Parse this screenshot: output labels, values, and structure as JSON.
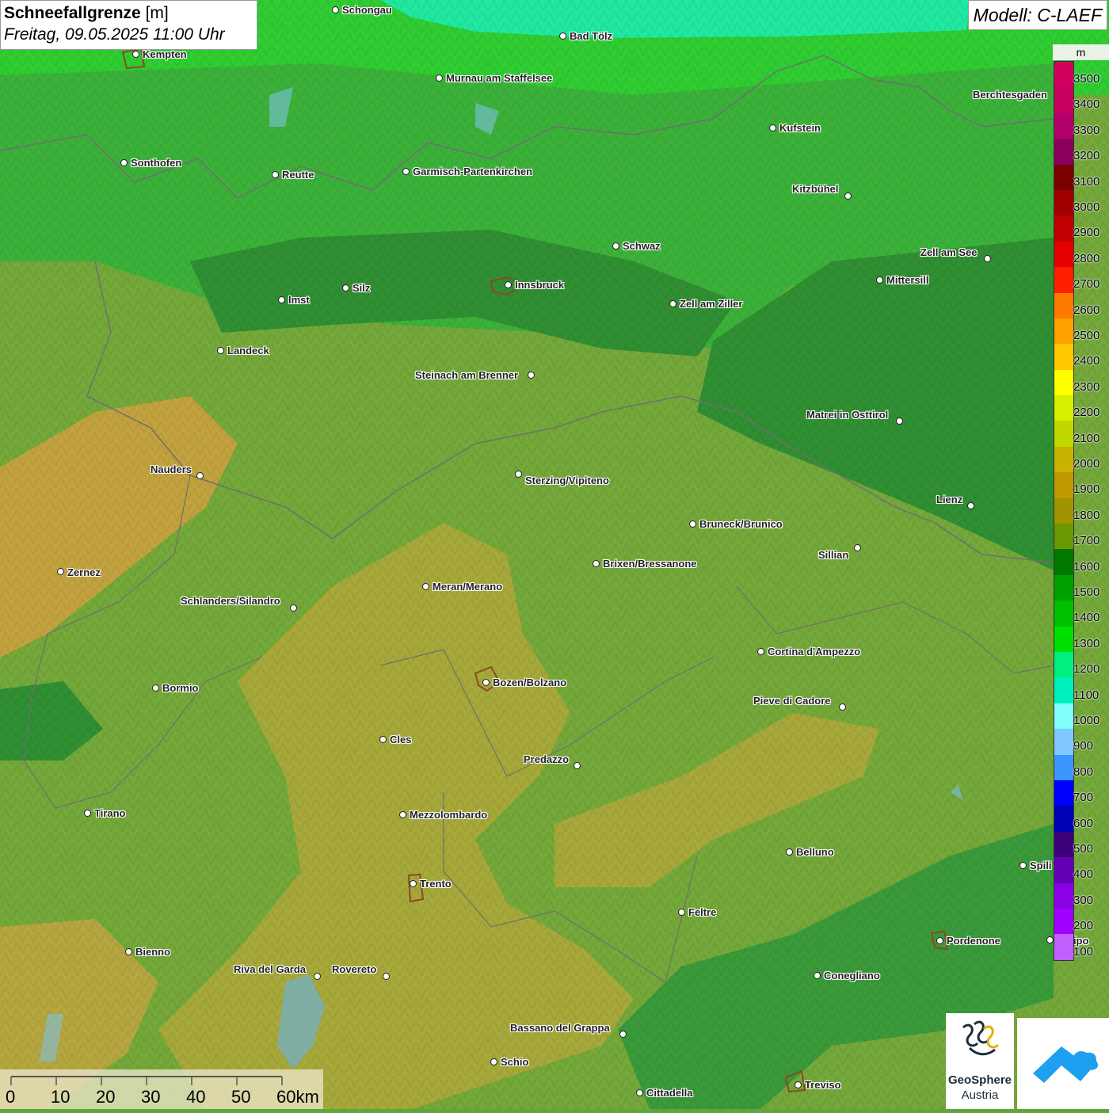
{
  "header": {
    "title_bold": "Schneefallgrenze",
    "title_unit": "[m]",
    "datetime": "Freitag, 09.05.2025 11:00 Uhr",
    "model": "Modell: C-LAEF"
  },
  "legend": {
    "unit": "m",
    "bins": [
      {
        "label": "3500",
        "color": "#d0005e"
      },
      {
        "label": "3400",
        "color": "#c80060"
      },
      {
        "label": "3300",
        "color": "#b3006a"
      },
      {
        "label": "3200",
        "color": "#8b005a"
      },
      {
        "label": "3100",
        "color": "#7a0000"
      },
      {
        "label": "3000",
        "color": "#a00000"
      },
      {
        "label": "2900",
        "color": "#c00000"
      },
      {
        "label": "2800",
        "color": "#e60000"
      },
      {
        "label": "2700",
        "color": "#ff2000"
      },
      {
        "label": "2600",
        "color": "#ff7a00"
      },
      {
        "label": "2500",
        "color": "#ffa000"
      },
      {
        "label": "2400",
        "color": "#ffc800"
      },
      {
        "label": "2300",
        "color": "#ffff00"
      },
      {
        "label": "2200",
        "color": "#d4f000"
      },
      {
        "label": "2100",
        "color": "#c0d800"
      },
      {
        "label": "2000",
        "color": "#c8b400"
      },
      {
        "label": "1900",
        "color": "#c09a00"
      },
      {
        "label": "1800",
        "color": "#a09400"
      },
      {
        "label": "1700",
        "color": "#6a9800"
      },
      {
        "label": "1600",
        "color": "#007800"
      },
      {
        "label": "1500",
        "color": "#00a000"
      },
      {
        "label": "1400",
        "color": "#00c000"
      },
      {
        "label": "1300",
        "color": "#00e000"
      },
      {
        "label": "1200",
        "color": "#00f080"
      },
      {
        "label": "1100",
        "color": "#00f0c0"
      },
      {
        "label": "1000",
        "color": "#80ffff"
      },
      {
        "label": "900",
        "color": "#80c8ff"
      },
      {
        "label": "800",
        "color": "#3c96ff"
      },
      {
        "label": "700",
        "color": "#0000ff"
      },
      {
        "label": "600",
        "color": "#0000b4"
      },
      {
        "label": "500",
        "color": "#3c0078"
      },
      {
        "label": "400",
        "color": "#6400b4"
      },
      {
        "label": "300",
        "color": "#8c00e6"
      },
      {
        "label": "200",
        "color": "#a000ff"
      },
      {
        "label": "100",
        "color": "#c060ff"
      }
    ]
  },
  "cities": [
    {
      "name": "Schongau",
      "side": "right"
    },
    {
      "name": "Bad Tölz",
      "side": "right"
    },
    {
      "name": "Kempten",
      "side": "right"
    },
    {
      "name": "Murnau am Staffelsee",
      "side": "right"
    },
    {
      "name": "Berchtesgaden",
      "side": "left"
    },
    {
      "name": "Kufstein",
      "side": "right"
    },
    {
      "name": "Sonthofen",
      "side": "right"
    },
    {
      "name": "Reutte",
      "side": "right"
    },
    {
      "name": "Garmisch-Partenkirchen",
      "side": "right"
    },
    {
      "name": "Kitzbühel",
      "side": "left"
    },
    {
      "name": "Schwaz",
      "side": "right"
    },
    {
      "name": "Zell am See",
      "side": "left"
    },
    {
      "name": "Innsbruck",
      "side": "right"
    },
    {
      "name": "Silz",
      "side": "right"
    },
    {
      "name": "Imst",
      "side": "right"
    },
    {
      "name": "Mittersill",
      "side": "right"
    },
    {
      "name": "Zell am Ziller",
      "side": "right"
    },
    {
      "name": "Landeck",
      "side": "right"
    },
    {
      "name": "Steinach am Brenner",
      "side": "left"
    },
    {
      "name": "Matrei in Osttirol",
      "side": "left"
    },
    {
      "name": "Nauders",
      "side": "left"
    },
    {
      "name": "Sterzing/Vipiteno",
      "side": "right"
    },
    {
      "name": "Lienz",
      "side": "left"
    },
    {
      "name": "Bruneck/Brunico",
      "side": "right"
    },
    {
      "name": "Sillian",
      "side": "left"
    },
    {
      "name": "Brixen/Bressanone",
      "side": "right"
    },
    {
      "name": "Zernez",
      "side": "right"
    },
    {
      "name": "Meran/Merano",
      "side": "right"
    },
    {
      "name": "Schlanders/Silandro",
      "side": "left"
    },
    {
      "name": "Cortina d'Ampezzo",
      "side": "right"
    },
    {
      "name": "Bozen/Bolzano",
      "side": "right"
    },
    {
      "name": "Bormio",
      "side": "right"
    },
    {
      "name": "Pieve di Cadore",
      "side": "left"
    },
    {
      "name": "Cles",
      "side": "right"
    },
    {
      "name": "Predazzo",
      "side": "left"
    },
    {
      "name": "Tirano",
      "side": "right"
    },
    {
      "name": "Mezzolombardo",
      "side": "right"
    },
    {
      "name": "Belluno",
      "side": "right"
    },
    {
      "name": "Spili",
      "side": "right"
    },
    {
      "name": "Trento",
      "side": "right"
    },
    {
      "name": "Feltre",
      "side": "right"
    },
    {
      "name": "Pordenone",
      "side": "right"
    },
    {
      "name": "droipo",
      "side": "right"
    },
    {
      "name": "Bienno",
      "side": "right"
    },
    {
      "name": "Riva del Garda",
      "side": "left"
    },
    {
      "name": "Rovereto",
      "side": "left"
    },
    {
      "name": "Conegliano",
      "side": "right"
    },
    {
      "name": "Bassano del Grappa",
      "side": "left"
    },
    {
      "name": "Schio",
      "side": "right"
    },
    {
      "name": "Treviso",
      "side": "right"
    },
    {
      "name": "Cittadella",
      "side": "right"
    }
  ],
  "scalebar": {
    "ticks": [
      "0",
      "10",
      "20",
      "30",
      "40",
      "50",
      "60km"
    ]
  },
  "logos": {
    "geosphere_line1": "GeoSphere",
    "geosphere_line2": "Austria"
  }
}
